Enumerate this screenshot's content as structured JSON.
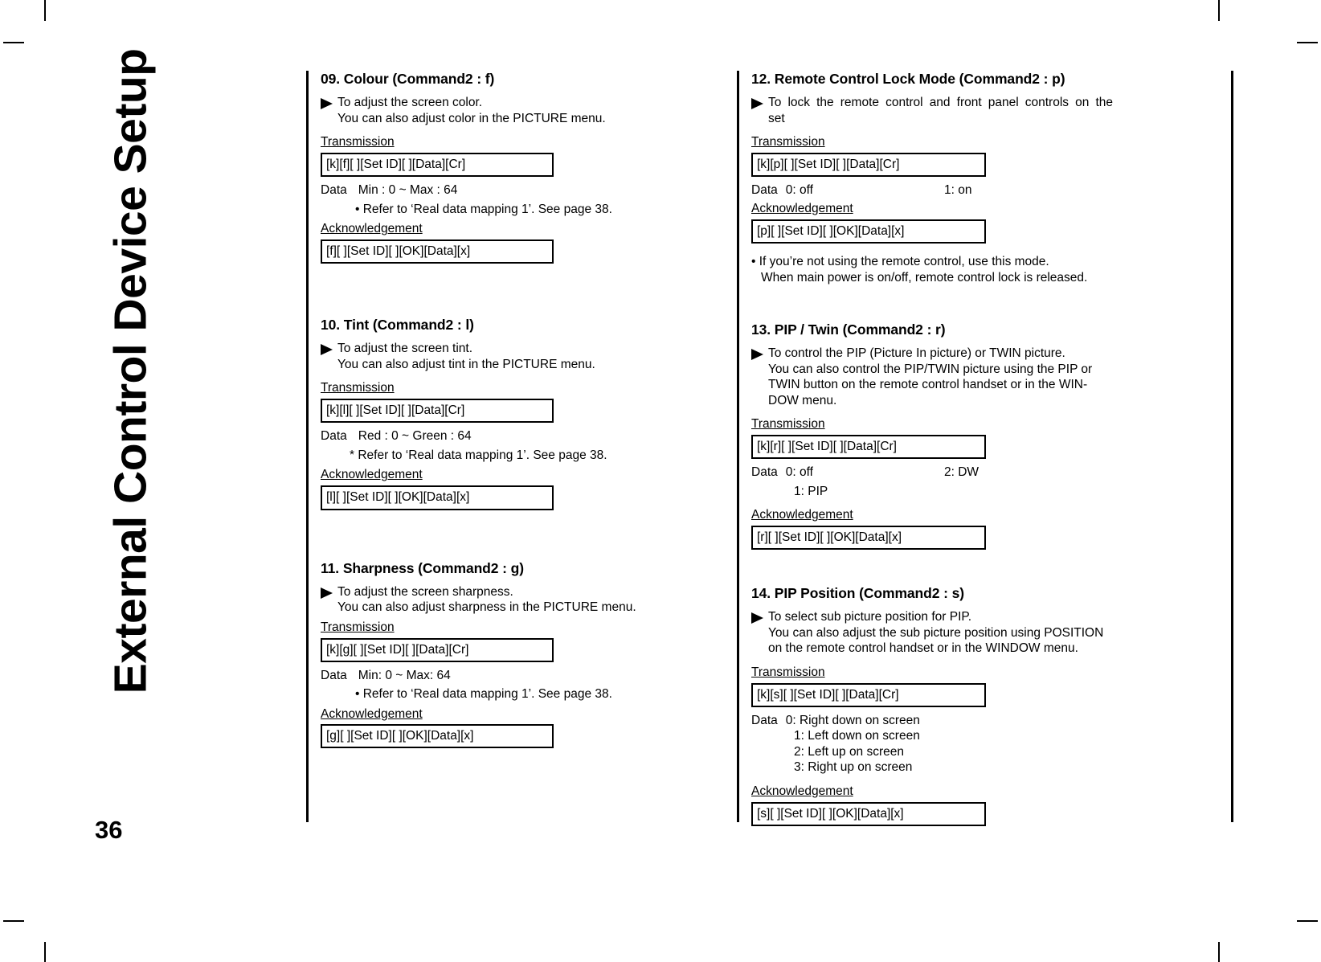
{
  "page": {
    "running_head": "External Control Device Setup",
    "page_number": "36"
  },
  "labels": {
    "transmission": "Transmission",
    "acknowledgement": "Acknowledgement",
    "data": "Data",
    "triangle_icon": "triangle-right-icon",
    "bullet_icon": "bullet-dot"
  },
  "sections": {
    "colour": {
      "title": "09. Colour (Command2 : f)",
      "desc_line1": "To adjust the screen color.",
      "desc_line2": "You can also adjust color in the PICTURE menu.",
      "transmission_code": "[k][f][  ][Set ID][  ][Data][Cr]",
      "data_label": "Data",
      "data_value": "Min : 0 ~ Max : 64",
      "note": "• Refer to ‘Real data mapping 1’. See page 38.",
      "ack_code": "[f][  ][Set ID][  ][OK][Data][x]"
    },
    "tint": {
      "title": "10. Tint (Command2 : l)",
      "desc_line1": "To adjust the screen tint.",
      "desc_line2": "You can also adjust tint in the PICTURE menu.",
      "transmission_code": "[k][l][  ][Set ID][  ][Data][Cr]",
      "data_label": "Data",
      "data_value": "Red : 0 ~ Green : 64",
      "note": "* Refer to ‘Real data mapping 1’. See page 38.",
      "ack_code": "[l][  ][Set ID][  ][OK][Data][x]"
    },
    "sharpness": {
      "title": "11. Sharpness (Command2 : g)",
      "desc_line1": "To adjust the screen sharpness.",
      "desc_line2": "You can also adjust sharpness in the PICTURE menu.",
      "transmission_code": "[k][g][  ][Set ID][  ][Data][Cr]",
      "data_label": "Data",
      "data_value": "Min: 0 ~ Max: 64",
      "note": "• Refer to ‘Real data mapping 1’. See page 38.",
      "ack_code": "[g][  ][Set ID][  ][OK][Data][x]"
    },
    "remote_lock": {
      "title": "12. Remote Control Lock Mode (Command2 : p)",
      "desc_line1": "To lock the remote control and front panel controls on the",
      "desc_line2": "set",
      "transmission_code": "[k][p][  ][Set ID][  ][Data][Cr]",
      "data_label": "Data",
      "data_value_0": "0: off",
      "data_value_1": "1: on",
      "ack_code": "[p][  ][Set ID][  ][OK][Data][x]",
      "note_line1": "• If you’re not using the remote control, use this mode.",
      "note_line2": "When main power is on/off, remote control lock is released."
    },
    "pip_twin": {
      "title": "13. PIP / Twin (Command2 : r)",
      "desc_line1": "To control the PIP (Picture In picture) or TWIN picture.",
      "desc_line2": "You can also control the PIP/TWIN picture using the PIP or",
      "desc_line3": "TWIN button on the remote control handset or in the WIN-",
      "desc_line4": "DOW menu.",
      "transmission_code": "[k][r][  ][Set ID][  ][Data][Cr]",
      "data_label": "Data",
      "data_value_0": "0: off",
      "data_value_1": "1: PIP",
      "data_value_2": "2: DW",
      "ack_code": "[r][  ][Set ID][  ][OK][Data][x]"
    },
    "pip_position": {
      "title": "14. PIP Position (Command2 : s)",
      "desc_line1": "To select sub picture position for PIP.",
      "desc_line2": "You can also adjust the sub picture position using POSITION",
      "desc_line3": "on the remote control handset or in the WINDOW menu.",
      "transmission_code": "[k][s][  ][Set ID][  ][Data][Cr]",
      "data_label": "Data",
      "data_items": [
        "0: Right down on screen",
        "1: Left down on screen",
        "2: Left up on screen",
        "3: Right up on screen"
      ],
      "ack_code": "[s][  ][Set ID][  ][OK][Data][x]"
    }
  }
}
